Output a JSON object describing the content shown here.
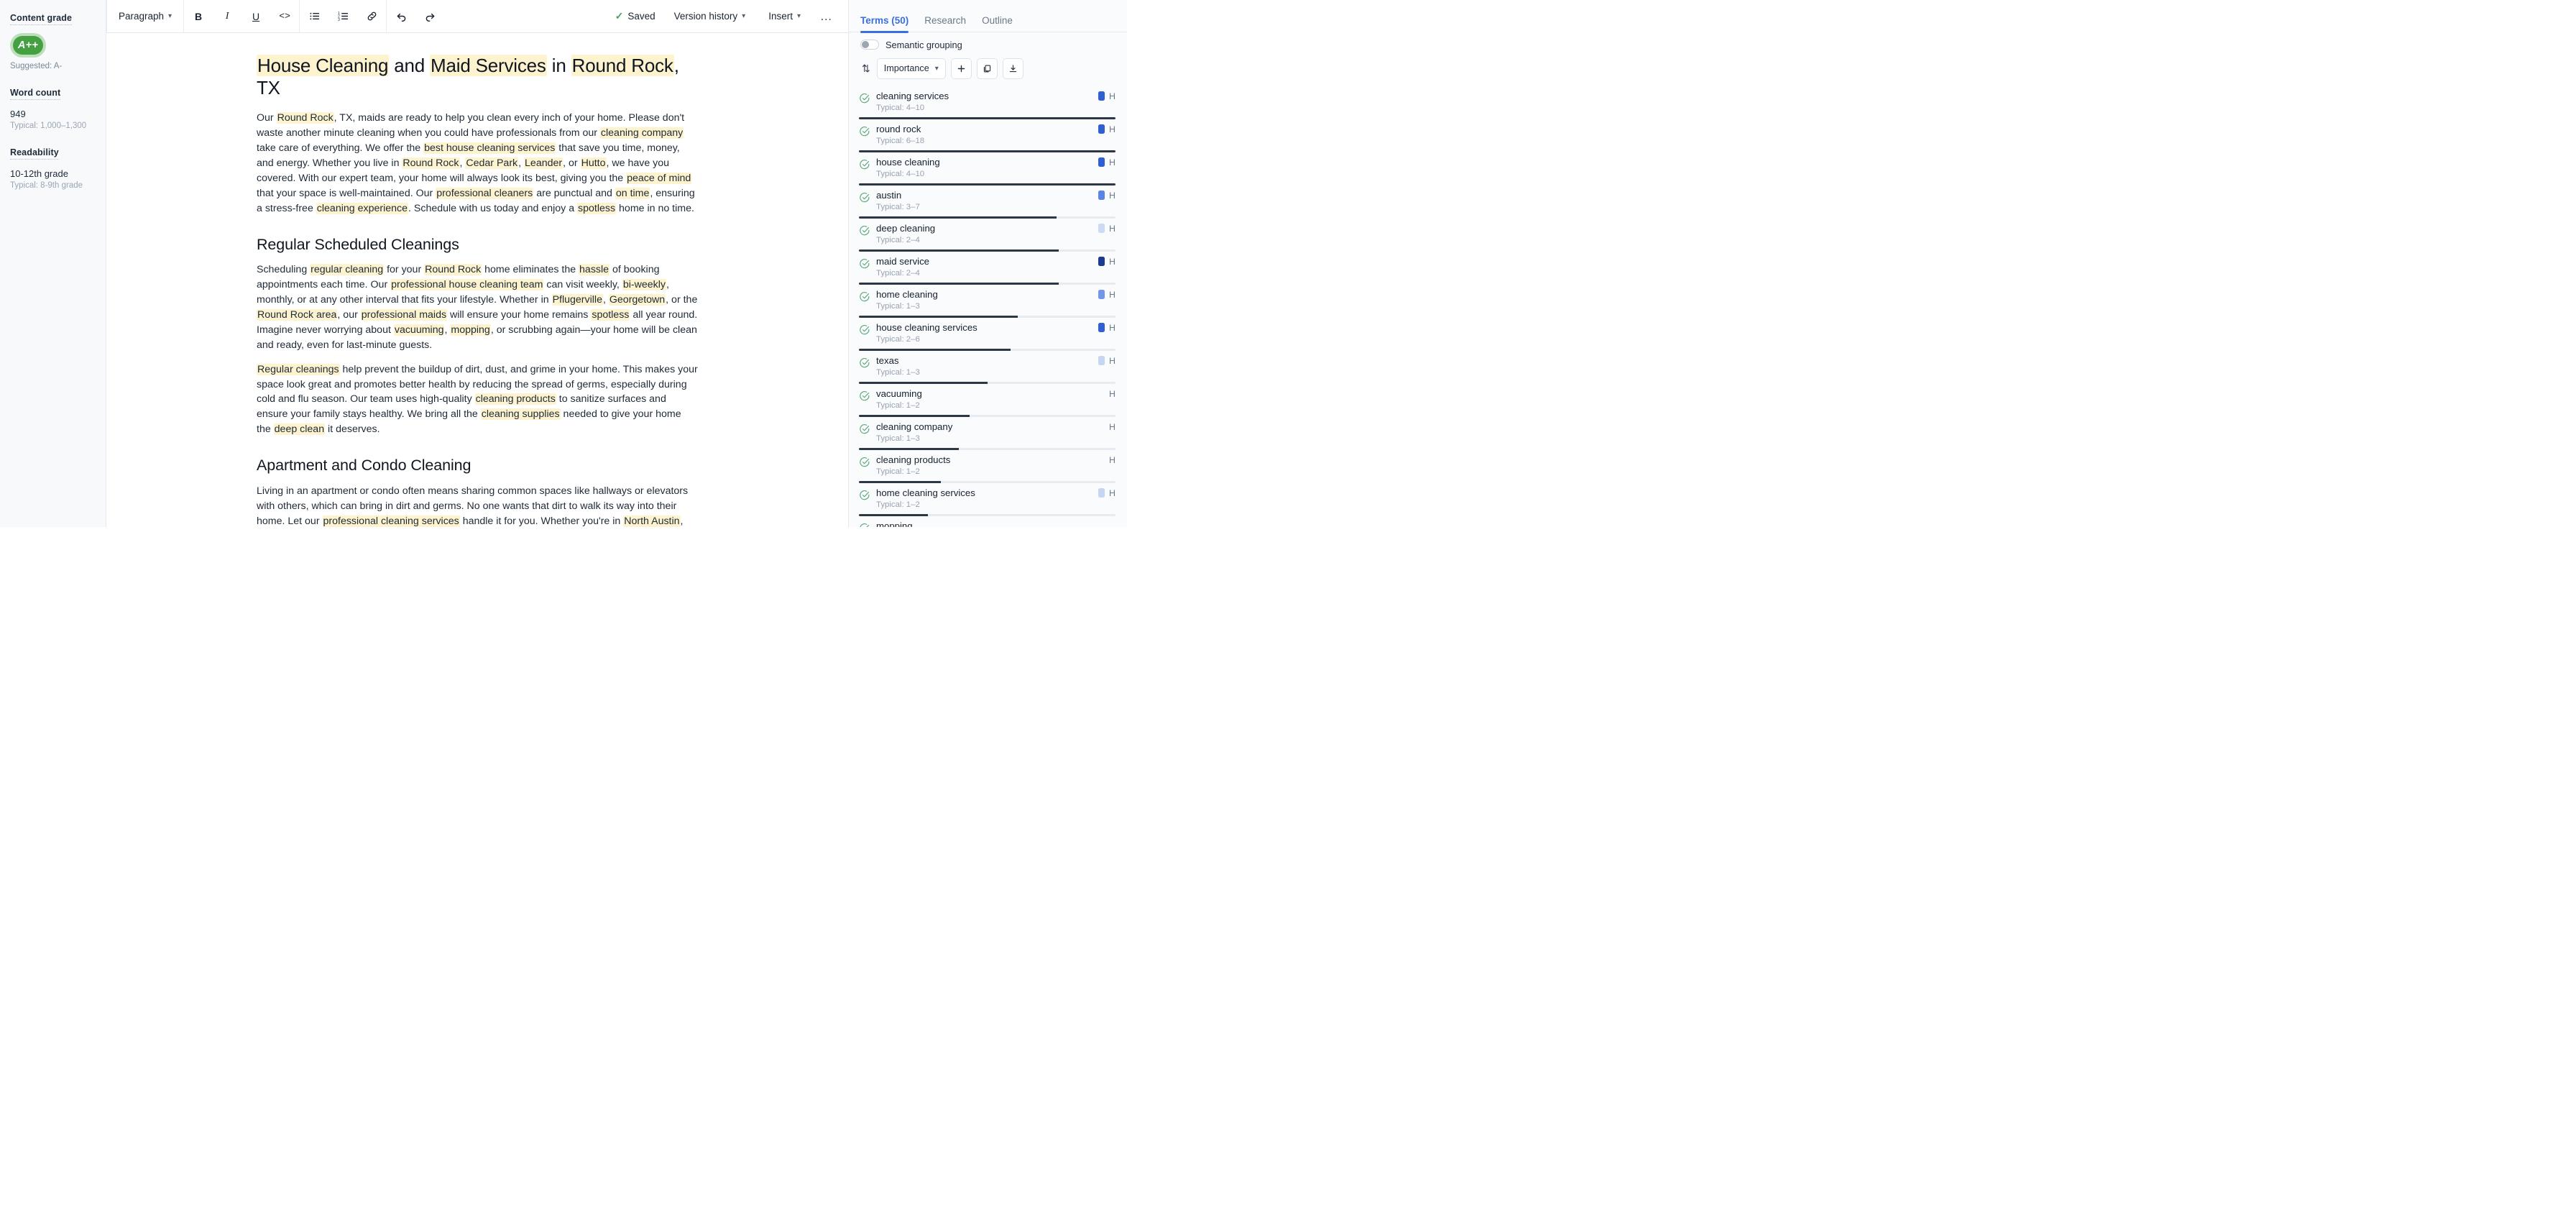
{
  "sidebar": {
    "content_grade": {
      "title": "Content grade",
      "grade": "A++",
      "suggested": "Suggested: A-"
    },
    "word_count": {
      "title": "Word count",
      "value": "949",
      "typical": "Typical: 1,000–1,300"
    },
    "readability": {
      "title": "Readability",
      "value": "10-12th grade",
      "typical": "Typical: 8-9th grade"
    }
  },
  "toolbar": {
    "style_dropdown": "Paragraph",
    "bold": "B",
    "italic": "I",
    "underline": "U",
    "code": "<>",
    "bullet_list_icon": "bullet-list-icon",
    "numbered_list_icon": "numbered-list-icon",
    "link_icon": "link-icon",
    "undo_icon": "undo-icon",
    "redo_icon": "redo-icon",
    "saved_label": "Saved",
    "version_history": "Version history",
    "insert": "Insert",
    "more_label": "…"
  },
  "document": {
    "title_parts": [
      {
        "t": "House Cleaning",
        "h": "y"
      },
      {
        "t": " and ",
        "h": ""
      },
      {
        "t": "Maid Services",
        "h": "y"
      },
      {
        "t": " in ",
        "h": ""
      },
      {
        "t": "Round Rock",
        "h": "y"
      },
      {
        "t": ", TX",
        "h": ""
      }
    ],
    "intro": "Our Round Rock, TX, maids are ready to help you clean every inch of your home. Please don't waste another minute cleaning when you could have professionals from our cleaning company take care of everything. We offer the best house cleaning services that save you time, money, and energy. Whether you live in Round Rock, Cedar Park, Leander, or Hutto, we have you covered. With our expert team, your home will always look its best, giving you the peace of mind that your space is well-maintained. Our professional cleaners are punctual and on time, ensuring a stress-free cleaning experience. Schedule with us today and enjoy a spotless home in no time.",
    "h2_regular": "Regular Scheduled Cleanings",
    "p_regular_1": "Scheduling regular cleaning for your Round Rock home eliminates the hassle of booking appointments each time. Our professional house cleaning team can visit weekly, bi-weekly, monthly, or at any other interval that fits your lifestyle. Whether in Pflugerville, Georgetown, or the Round Rock area, our professional maids will ensure your home remains spotless all year round. Imagine never worrying about vacuuming, mopping, or scrubbing again—your home will be clean and ready, even for last-minute guests.",
    "p_regular_2": "Regular cleanings help prevent the buildup of dirt, dust, and grime in your home. This makes your space look great and promotes better health by reducing the spread of germs, especially during cold and flu season. Our team uses high-quality cleaning products to sanitize surfaces and ensure your family stays healthy. We bring all the cleaning supplies needed to give your home the deep clean it deserves.",
    "h2_apartment": "Apartment and Condo Cleaning",
    "p_apartment": "Living in an apartment or condo often means sharing common spaces like hallways or elevators with others, which can bring in dirt and germs. No one wants that dirt to walk its way into their home. Let our professional cleaning services handle it for you. Whether you're in North Austin, Pflugerville, or Leander, we'll ensure your home stays clean and sanitary. We can arrange a deep cleaning of your apartment or condo or provide a quick clean-up before guests arrive. This way, you'll have more time to relax and enjoy your home."
  },
  "right_panel": {
    "tabs": [
      {
        "label": "Terms (50)",
        "active": true
      },
      {
        "label": "Research",
        "active": false
      },
      {
        "label": "Outline",
        "active": false
      }
    ],
    "semantic_grouping_label": "Semantic grouping",
    "semantic_grouping_on": false,
    "sort_icon": "sort-arrows-icon",
    "sort_by": "Importance",
    "add_icon": "plus-icon",
    "copy_icon": "copy-icon",
    "download_icon": "download-icon",
    "heading_flag": "H",
    "terms": [
      {
        "name": "cleaning services",
        "typical": "Typical: 4–10",
        "badge": "#2f5fd0",
        "fill": 100
      },
      {
        "name": "round rock",
        "typical": "Typical: 6–18",
        "badge": "#2f5fd0",
        "fill": 100
      },
      {
        "name": "house cleaning",
        "typical": "Typical: 4–10",
        "badge": "#2f5fd0",
        "fill": 100
      },
      {
        "name": "austin",
        "typical": "Typical: 3–7",
        "badge": "#5b84e4",
        "fill": 77
      },
      {
        "name": "deep cleaning",
        "typical": "Typical: 2–4",
        "badge": "#cdd9f5",
        "fill": 78
      },
      {
        "name": "maid service",
        "typical": "Typical: 2–4",
        "badge": "#1b3a91",
        "fill": 78
      },
      {
        "name": "home cleaning",
        "typical": "Typical: 1–3",
        "badge": "#7296ea",
        "fill": 62
      },
      {
        "name": "house cleaning services",
        "typical": "Typical: 2–6",
        "badge": "#2f5fd0",
        "fill": 59
      },
      {
        "name": "texas",
        "typical": "Typical: 1–3",
        "badge": "#c6d5f4",
        "fill": 50
      },
      {
        "name": "vacuuming",
        "typical": "Typical: 1–2",
        "badge": "",
        "fill": 43
      },
      {
        "name": "cleaning company",
        "typical": "Typical: 1–3",
        "badge": "",
        "fill": 39
      },
      {
        "name": "cleaning products",
        "typical": "Typical: 1–2",
        "badge": "",
        "fill": 32
      },
      {
        "name": "home cleaning services",
        "typical": "Typical: 1–2",
        "badge": "#c6d5f4",
        "fill": 27
      },
      {
        "name": "mopping",
        "typical": "",
        "badge": "",
        "fill": 0
      }
    ]
  }
}
